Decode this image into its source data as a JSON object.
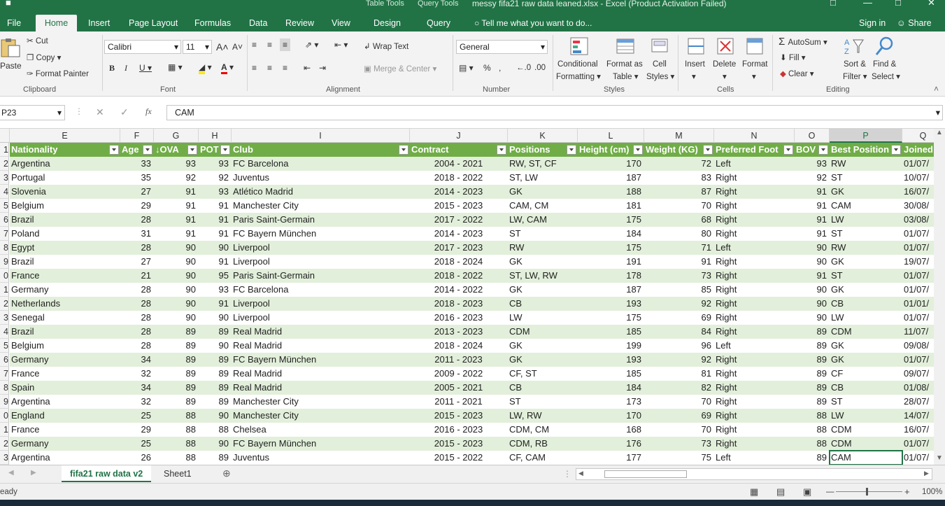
{
  "window": {
    "title": "messy fifa21 raw data leaned.xlsx - Excel (Product Activation Failed)",
    "context_tabs": [
      "Table Tools",
      "Query Tools"
    ]
  },
  "tabs": [
    "File",
    "Home",
    "Insert",
    "Page Layout",
    "Formulas",
    "Data",
    "Review",
    "View",
    "Design",
    "Query"
  ],
  "active_tab": "Home",
  "tell_me": "Tell me what you want to do...",
  "sign_in": "Sign in",
  "share": "Share",
  "ribbon": {
    "clipboard": {
      "label": "Clipboard",
      "paste": "Paste",
      "cut": "Cut",
      "copy": "Copy",
      "format_painter": "Format Painter"
    },
    "font": {
      "label": "Font",
      "name": "Calibri",
      "size": "11"
    },
    "alignment": {
      "label": "Alignment",
      "wrap": "Wrap Text",
      "merge": "Merge & Center"
    },
    "number": {
      "label": "Number",
      "format": "General"
    },
    "styles": {
      "label": "Styles",
      "conditional": "Conditional",
      "conditional2": "Formatting",
      "format_as": "Format as",
      "format_as2": "Table",
      "cell": "Cell",
      "cell2": "Styles"
    },
    "cells": {
      "label": "Cells",
      "insert": "Insert",
      "delete": "Delete",
      "format": "Format"
    },
    "editing": {
      "label": "Editing",
      "autosum": "AutoSum",
      "fill": "Fill",
      "clear": "Clear",
      "sort": "Sort &",
      "sort2": "Filter",
      "find": "Find &",
      "find2": "Select"
    }
  },
  "formula_bar": {
    "name_box": "P23",
    "value": "CAM"
  },
  "columns": [
    {
      "letter": "E"
    },
    {
      "letter": "F"
    },
    {
      "letter": "G"
    },
    {
      "letter": "H"
    },
    {
      "letter": "I"
    },
    {
      "letter": "J"
    },
    {
      "letter": "K"
    },
    {
      "letter": "L"
    },
    {
      "letter": "M"
    },
    {
      "letter": "N"
    },
    {
      "letter": "O"
    },
    {
      "letter": "P"
    },
    {
      "letter": "Q"
    }
  ],
  "headers": [
    "Nationality",
    "Age",
    "↓OVA",
    "POT",
    "Club",
    "Contract",
    "Positions",
    "Height (cm)",
    "Weight (KG)",
    "Preferred Foot",
    "BOV",
    "Best Position",
    "Joined"
  ],
  "row_numbers": [
    "1",
    "2",
    "3",
    "4",
    "5",
    "6",
    "7",
    "8",
    "9",
    "0",
    "1",
    "2",
    "3",
    "4",
    "5",
    "6",
    "7",
    "8",
    "9",
    "0",
    "1",
    "2",
    "3"
  ],
  "rows": [
    [
      "Argentina",
      "33",
      "93",
      "93",
      "FC Barcelona",
      "2004 - 2021",
      "RW, ST, CF",
      "170",
      "72",
      "Left",
      "93",
      "RW",
      "01/07/"
    ],
    [
      "Portugal",
      "35",
      "92",
      "92",
      "Juventus",
      "2018 - 2022",
      "ST, LW",
      "187",
      "83",
      "Right",
      "92",
      "ST",
      "10/07/"
    ],
    [
      "Slovenia",
      "27",
      "91",
      "93",
      "Atlético Madrid",
      "2014 - 2023",
      "GK",
      "188",
      "87",
      "Right",
      "91",
      "GK",
      "16/07/"
    ],
    [
      "Belgium",
      "29",
      "91",
      "91",
      "Manchester City",
      "2015 - 2023",
      "CAM, CM",
      "181",
      "70",
      "Right",
      "91",
      "CAM",
      "30/08/"
    ],
    [
      "Brazil",
      "28",
      "91",
      "91",
      "Paris Saint-Germain",
      "2017 - 2022",
      "LW, CAM",
      "175",
      "68",
      "Right",
      "91",
      "LW",
      "03/08/"
    ],
    [
      "Poland",
      "31",
      "91",
      "91",
      "FC Bayern München",
      "2014 - 2023",
      "ST",
      "184",
      "80",
      "Right",
      "91",
      "ST",
      "01/07/"
    ],
    [
      "Egypt",
      "28",
      "90",
      "90",
      "Liverpool",
      "2017 - 2023",
      "RW",
      "175",
      "71",
      "Left",
      "90",
      "RW",
      "01/07/"
    ],
    [
      "Brazil",
      "27",
      "90",
      "91",
      "Liverpool",
      "2018 - 2024",
      "GK",
      "191",
      "91",
      "Right",
      "90",
      "GK",
      "19/07/"
    ],
    [
      "France",
      "21",
      "90",
      "95",
      "Paris Saint-Germain",
      "2018 - 2022",
      "ST, LW, RW",
      "178",
      "73",
      "Right",
      "91",
      "ST",
      "01/07/"
    ],
    [
      "Germany",
      "28",
      "90",
      "93",
      "FC Barcelona",
      "2014 - 2022",
      "GK",
      "187",
      "85",
      "Right",
      "90",
      "GK",
      "01/07/"
    ],
    [
      "Netherlands",
      "28",
      "90",
      "91",
      "Liverpool",
      "2018 - 2023",
      "CB",
      "193",
      "92",
      "Right",
      "90",
      "CB",
      "01/01/"
    ],
    [
      "Senegal",
      "28",
      "90",
      "90",
      "Liverpool",
      "2016 - 2023",
      "LW",
      "175",
      "69",
      "Right",
      "90",
      "LW",
      "01/07/"
    ],
    [
      "Brazil",
      "28",
      "89",
      "89",
      "Real Madrid",
      "2013 - 2023",
      "CDM",
      "185",
      "84",
      "Right",
      "89",
      "CDM",
      "11/07/"
    ],
    [
      "Belgium",
      "28",
      "89",
      "90",
      "Real Madrid",
      "2018 - 2024",
      "GK",
      "199",
      "96",
      "Left",
      "89",
      "GK",
      "09/08/"
    ],
    [
      "Germany",
      "34",
      "89",
      "89",
      "FC Bayern München",
      "2011 - 2023",
      "GK",
      "193",
      "92",
      "Right",
      "89",
      "GK",
      "01/07/"
    ],
    [
      "France",
      "32",
      "89",
      "89",
      "Real Madrid",
      "2009 - 2022",
      "CF, ST",
      "185",
      "81",
      "Right",
      "89",
      "CF",
      "09/07/"
    ],
    [
      "Spain",
      "34",
      "89",
      "89",
      "Real Madrid",
      "2005 - 2021",
      "CB",
      "184",
      "82",
      "Right",
      "89",
      "CB",
      "01/08/"
    ],
    [
      "Argentina",
      "32",
      "89",
      "89",
      "Manchester City",
      "2011 - 2021",
      "ST",
      "173",
      "70",
      "Right",
      "89",
      "ST",
      "28/07/"
    ],
    [
      "England",
      "25",
      "88",
      "90",
      "Manchester City",
      "2015 - 2023",
      "LW, RW",
      "170",
      "69",
      "Right",
      "88",
      "LW",
      "14/07/"
    ],
    [
      "France",
      "29",
      "88",
      "88",
      "Chelsea",
      "2016 - 2023",
      "CDM, CM",
      "168",
      "70",
      "Right",
      "88",
      "CDM",
      "16/07/"
    ],
    [
      "Germany",
      "25",
      "88",
      "90",
      "FC Bayern München",
      "2015 - 2023",
      "CDM, RB",
      "176",
      "73",
      "Right",
      "88",
      "CDM",
      "01/07/"
    ],
    [
      "Argentina",
      "26",
      "88",
      "89",
      "Juventus",
      "2015 - 2022",
      "CF, CAM",
      "177",
      "75",
      "Left",
      "89",
      "CAM",
      "01/07/"
    ]
  ],
  "sheets": [
    "fifa21 raw data v2",
    "Sheet1"
  ],
  "active_sheet": "fifa21 raw data v2",
  "status": {
    "ready": "eady",
    "zoom": "100%"
  },
  "colors": {
    "accent": "#217346",
    "table_header": "#70ad47",
    "band": "#e2efda"
  }
}
